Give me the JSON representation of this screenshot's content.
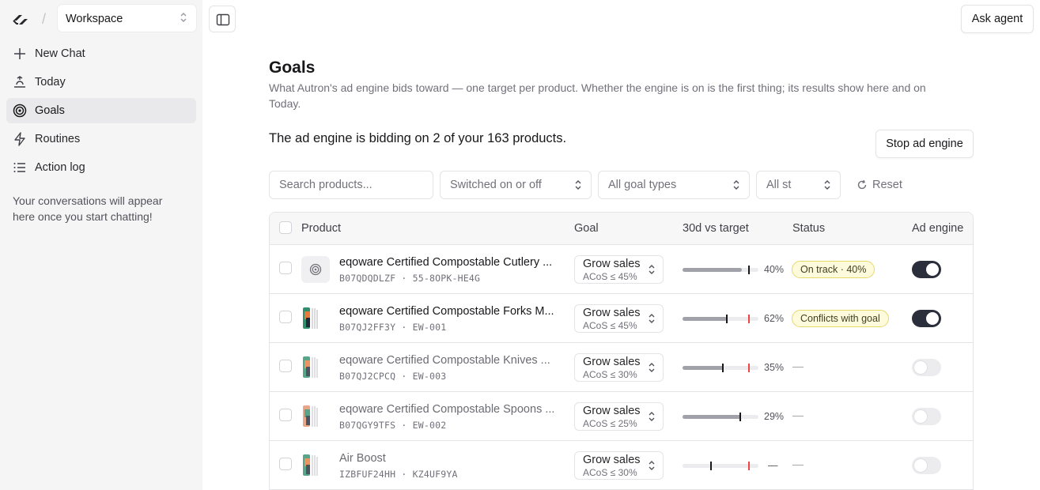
{
  "sidebar": {
    "workspace": "Workspace",
    "items": [
      {
        "label": "New Chat",
        "icon": "plus-icon"
      },
      {
        "label": "Today",
        "icon": "today-icon"
      },
      {
        "label": "Goals",
        "icon": "target-icon",
        "active": true
      },
      {
        "label": "Routines",
        "icon": "bolt-icon"
      },
      {
        "label": "Action log",
        "icon": "list-icon"
      }
    ],
    "empty_note": "Your conversations will appear here once you start chatting!"
  },
  "header": {
    "ask_agent": "Ask agent"
  },
  "page": {
    "title": "Goals",
    "subtitle": "What Autron's ad engine bids toward — one target per product. Whether the engine is on is the first thing; its results show here and on Today.",
    "engine_status": "The ad engine is bidding on 2 of your 163 products.",
    "stop_button": "Stop ad engine"
  },
  "filters": {
    "search_placeholder": "Search products...",
    "switch": "Switched on or off",
    "goal_types": "All goal types",
    "status": "All st",
    "reset": "Reset"
  },
  "table": {
    "columns": [
      "Product",
      "Goal",
      "30d vs target",
      "Status",
      "Ad engine"
    ],
    "rows": [
      {
        "name": "eqoware Certified Compostable Cutlery ...",
        "meta": "B07QDQDLZF · 55-8OPK-HE4G",
        "goal": "Grow sales",
        "goal_sub": "ACoS ≤ 45%",
        "progress": 0.78,
        "pct": "40%",
        "status": "On track · 40%",
        "engine_on": true
      },
      {
        "name": "eqoware Certified Compostable Forks M...",
        "meta": "B07QJ2FF3Y · EW-001",
        "goal": "Grow sales",
        "goal_sub": "ACoS ≤ 45%",
        "progress": 0.58,
        "pct": "62%",
        "status": "Conflicts with goal",
        "engine_on": true
      },
      {
        "name": "eqoware Certified Compostable Knives ...",
        "meta": "B07QJ2CPCQ · EW-003",
        "goal": "Grow sales",
        "goal_sub": "ACoS ≤ 30%",
        "progress": 0.54,
        "pct": "35%",
        "status": "—",
        "engine_on": false
      },
      {
        "name": "eqoware Certified Compostable Spoons ...",
        "meta": "B07QGY9TFS · EW-002",
        "goal": "Grow sales",
        "goal_sub": "ACoS ≤ 25%",
        "progress": 0.77,
        "pct": "29%",
        "status": "—",
        "engine_on": false
      },
      {
        "name": "Air Boost",
        "meta": "IZBFUF24HH · KZ4UF9YA",
        "goal": "Grow sales",
        "goal_sub": "ACoS ≤ 30%",
        "progress": 0,
        "pct": "—",
        "status": "—",
        "engine_on": false
      }
    ]
  }
}
